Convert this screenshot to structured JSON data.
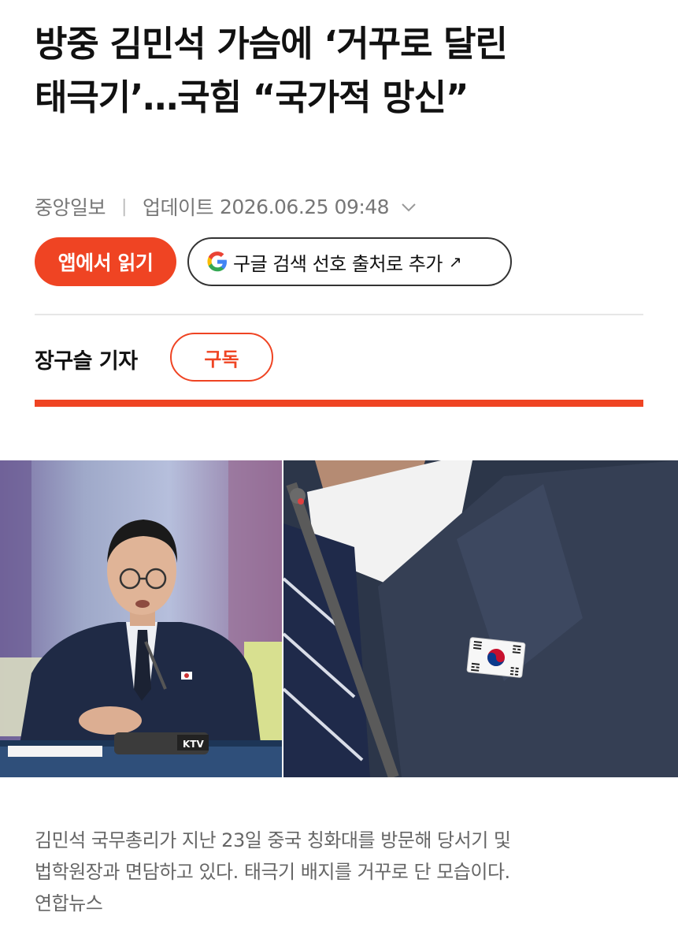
{
  "article": {
    "headline_line1": "방중 김민석 가슴에 ‘거꾸로 달린",
    "headline_line2": "태극기’…국힘 “국가적 망신”",
    "publisher": "중앙일보",
    "updated_label": "업데이트",
    "updated_time": "2026.06.25 09:48"
  },
  "actions": {
    "app_read_label": "앱에서 읽기",
    "google_pref_label": "구글 검색 선호 출처로 추가",
    "google_pref_arrow": "↗"
  },
  "reporter": {
    "name": "장구슬 기자",
    "subscribe_label": "구독"
  },
  "photo": {
    "left_watermark": "KTV"
  },
  "caption": {
    "line1": "김민석 국무총리가 지난 23일 중국 칭화대를 방문해 당서기 및",
    "line2": "법학원장과 면담하고 있다. 태극기 배지를 거꾸로 단 모습이다.",
    "credit": "연합뉴스"
  },
  "colors": {
    "accent": "#ef4423",
    "text": "#111111",
    "muted": "#777777"
  }
}
